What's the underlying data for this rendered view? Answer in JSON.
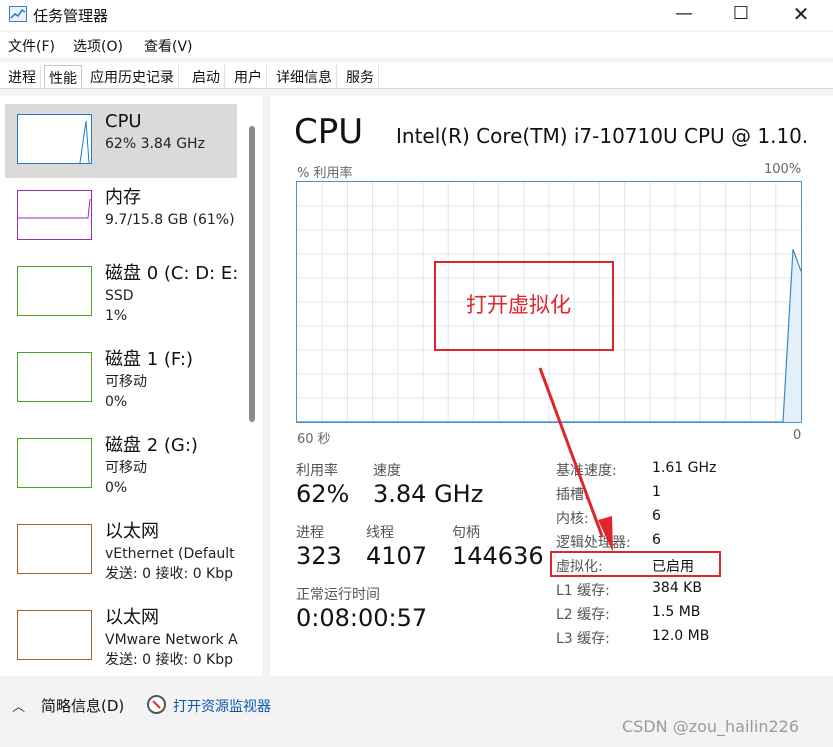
{
  "window": {
    "title": "任务管理器",
    "min_label": "—",
    "max_label": "☐",
    "close_label": "✕"
  },
  "menu": [
    "文件(F)",
    "选项(O)",
    "查看(V)"
  ],
  "tabs": [
    "进程",
    "性能",
    "应用历史记录",
    "启动",
    "用户",
    "详细信息",
    "服务"
  ],
  "active_tab": "性能",
  "sidebar": [
    {
      "name": "CPU",
      "line1": "62%  3.84 GHz",
      "line2": "",
      "color": "#1c7ad1",
      "selected": true
    },
    {
      "name": "内存",
      "line1": "9.7/15.8 GB (61%)",
      "line2": "",
      "color": "#9c2ab4",
      "selected": false
    },
    {
      "name": "磁盘 0 (C: D: E:",
      "line1": "SSD",
      "line2": "1%",
      "color": "#4aa421",
      "selected": false
    },
    {
      "name": "磁盘 1 (F:)",
      "line1": "可移动",
      "line2": "0%",
      "color": "#4aa421",
      "selected": false
    },
    {
      "name": "磁盘 2 (G:)",
      "line1": "可移动",
      "line2": "0%",
      "color": "#4aa421",
      "selected": false
    },
    {
      "name": "以太网",
      "line1": "vEthernet (Default",
      "line2": "发送: 0 接收: 0 Kbp",
      "color": "#a8642a",
      "selected": false
    },
    {
      "name": "以太网",
      "line1": "VMware Network A",
      "line2": "发送: 0 接收: 0 Kbp",
      "color": "#a8642a",
      "selected": false
    }
  ],
  "main": {
    "title": "CPU",
    "model": "Intel(R) Core(TM) i7-10710U CPU @ 1.10...",
    "util_label": "% 利用率",
    "max_label": "100%",
    "time_left": "60 秒",
    "time_right": "0",
    "graph_recent_value_pct": 72
  },
  "stats": {
    "util_label": "利用率",
    "util_value": "62%",
    "speed_label": "速度",
    "speed_value": "3.84 GHz",
    "proc_label": "进程",
    "proc_value": "323",
    "thread_label": "线程",
    "thread_value": "4107",
    "handle_label": "句柄",
    "handle_value": "144636",
    "uptime_label": "正常运行时间",
    "uptime_value": "0:08:00:57"
  },
  "details": [
    {
      "label": "基准速度:",
      "value": "1.61 GHz"
    },
    {
      "label": "插槽:",
      "value": "1"
    },
    {
      "label": "内核:",
      "value": "6"
    },
    {
      "label": "逻辑处理器:",
      "value": "6"
    },
    {
      "label": "虚拟化:",
      "value": "已启用"
    },
    {
      "label": "L1 缓存:",
      "value": "384 KB"
    },
    {
      "label": "L2 缓存:",
      "value": "1.5 MB"
    },
    {
      "label": "L3 缓存:",
      "value": "12.0 MB"
    }
  ],
  "annotation": {
    "text": "打开虚拟化",
    "color": "#e0262a"
  },
  "footer": {
    "chevron": "︿",
    "brief_label": "简略信息(D)",
    "monitor_label": "打开资源监视器",
    "watermark": "CSDN @zou_hailin226"
  }
}
